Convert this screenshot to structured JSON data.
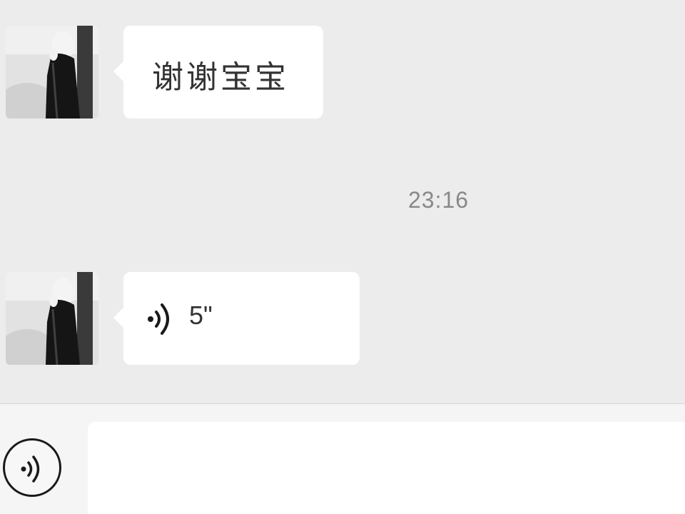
{
  "messages": [
    {
      "sender": "other",
      "type": "text",
      "text": "谢谢宝宝",
      "avatar_icon": "user-avatar-photo"
    },
    {
      "sender": "other",
      "type": "voice",
      "duration": "5\"",
      "icon": "voice-wave-icon",
      "avatar_icon": "user-avatar-photo"
    }
  ],
  "timestamp": "23:16",
  "input_bar": {
    "voice_toggle_icon": "voice-mode-icon",
    "input_value": "",
    "input_placeholder": ""
  },
  "colors": {
    "chat_background": "#ececec",
    "bubble_background": "#ffffff",
    "input_bar_background": "#f5f5f5",
    "timestamp_text": "#888888",
    "message_text": "#333333"
  }
}
